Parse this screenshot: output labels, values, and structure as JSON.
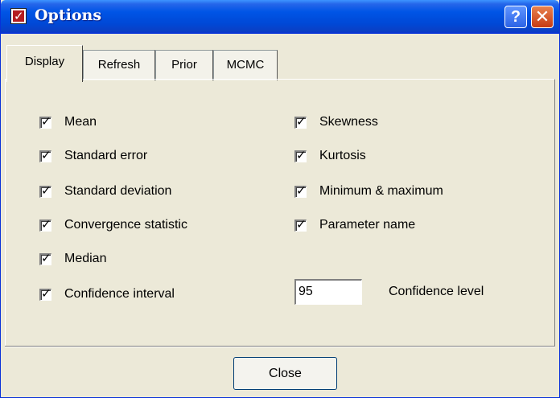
{
  "window": {
    "title": "Options"
  },
  "titlebar": {
    "help_glyph": "?",
    "close_glyph": "✕"
  },
  "tabs": [
    {
      "label": "Display",
      "active": true
    },
    {
      "label": "Refresh",
      "active": false
    },
    {
      "label": "Prior",
      "active": false
    },
    {
      "label": "MCMC",
      "active": false
    }
  ],
  "left_options": [
    {
      "label": "Mean",
      "checked": true
    },
    {
      "label": "Standard error",
      "checked": true
    },
    {
      "label": "Standard deviation",
      "checked": true
    },
    {
      "label": "Convergence statistic",
      "checked": true
    },
    {
      "label": "Median",
      "checked": true
    },
    {
      "label": "Confidence interval",
      "checked": true
    }
  ],
  "right_options": [
    {
      "label": "Skewness",
      "checked": true
    },
    {
      "label": "Kurtosis",
      "checked": true
    },
    {
      "label": "Minimum & maximum",
      "checked": true
    },
    {
      "label": "Parameter name",
      "checked": true
    }
  ],
  "confidence": {
    "value": "95",
    "label": "Confidence level"
  },
  "footer": {
    "close_label": "Close"
  }
}
